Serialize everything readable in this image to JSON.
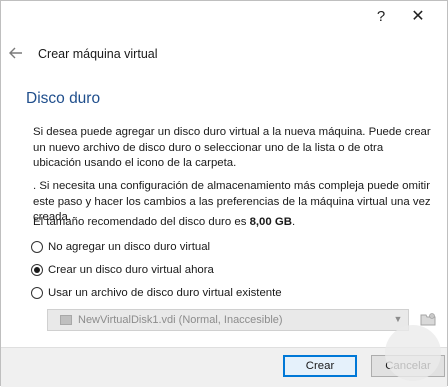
{
  "titlebar": {
    "help_label": "?",
    "close_label": "✕"
  },
  "header": {
    "back_icon": "arrow-left-icon",
    "title": "Crear máquina virtual"
  },
  "section": {
    "title": "Disco duro"
  },
  "paragraphs": [
    "Si desea puede agregar un disco duro virtual a la nueva máquina. Puede crear un nuevo archivo de disco duro o seleccionar uno de la lista o de otra ubicación usando el icono de la carpeta.",
    ". Si necesita una configuración de almacenamiento más compleja puede omitir este paso y hacer los cambios a las preferencias de la máquina virtual una vez creada."
  ],
  "recommended": {
    "prefix": "El tamaño recomendado del disco duro es ",
    "value": "8,00 GB",
    "suffix": "."
  },
  "options": [
    {
      "label": "No agregar un disco duro virtual",
      "selected": false
    },
    {
      "label": "Crear un disco duro virtual ahora",
      "selected": true
    },
    {
      "label": "Usar un archivo de disco duro virtual existente",
      "selected": false
    }
  ],
  "disk_select": {
    "value": "NewVirtualDisk1.vdi (Normal, Inaccesible)"
  },
  "buttons": {
    "create": "Crear",
    "cancel": "Cancelar"
  },
  "colors": {
    "accent": "#0078d7",
    "section_title": "#1f4e8c"
  }
}
